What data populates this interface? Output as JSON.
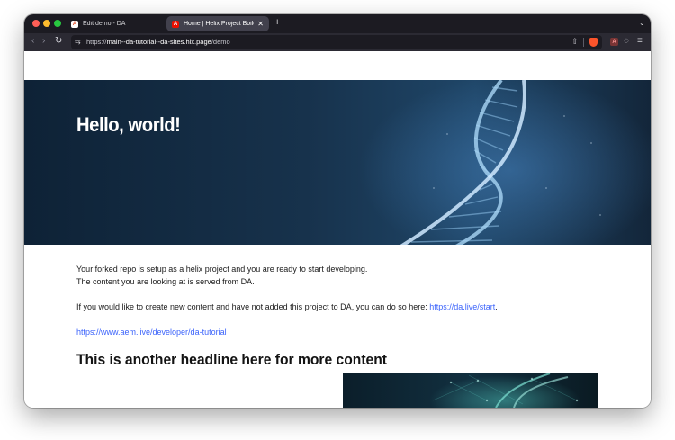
{
  "browser": {
    "tabs": [
      {
        "title": "Edit demo - DA",
        "favicon": "adobe-a-icon",
        "active": false
      },
      {
        "title": "Home | Helix Project Boilerplate",
        "favicon": "adobe-a-icon",
        "active": true
      }
    ],
    "new_tab_label": "+",
    "url_prefix": "https://",
    "url_host": "main--da-tutorial--da-sites.hlx.page",
    "url_path": "/demo"
  },
  "hero": {
    "title": "Hello, world!"
  },
  "content": {
    "paragraph1_line1": "Your forked repo is setup as a helix project and you are ready to start developing.",
    "paragraph1_line2": "The content you are looking at is served from DA.",
    "paragraph2_text": "If you would like to create new content and have not added this project to DA, you can do so here: ",
    "paragraph2_link": "https://da.live/start",
    "paragraph2_end": ".",
    "tutorial_link": "https://www.aem.live/developer/da-tutorial",
    "headline": "This is another headline here for more content"
  },
  "colors": {
    "link": "#3b63fb",
    "tabbar": "#1c1b22",
    "toolbar": "#2b2a33"
  }
}
